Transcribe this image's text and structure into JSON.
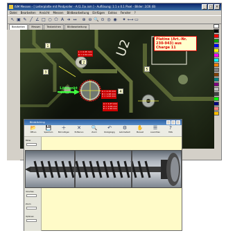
{
  "main_window": {
    "title": "ISM Messen - [ Leiterplatte mit Pindproller - A:\\1.1\\x.ism ] - Auflösung: 1:1 x 0.1 Pixel - Bilder: 2/26 (B)",
    "menu": [
      "Datei",
      "Bearbeiten",
      "Ansicht",
      "Messen",
      "Bildbearbeitung",
      "Einfügen",
      "Extras",
      "Fenster",
      "?"
    ],
    "tabs": [
      {
        "label": "Bearbeiten",
        "active": true
      },
      {
        "label": "Messen",
        "active": false
      },
      {
        "label": "Textzeichen",
        "active": false
      },
      {
        "label": "Bildbearbeitung",
        "active": false
      }
    ],
    "palette_colors": [
      "#ffffff",
      "#000000",
      "#ff0000",
      "#00a000",
      "#0000ff",
      "#ffff00",
      "#ff00ff",
      "#00ffff",
      "#ff8000",
      "#808080",
      "#804000",
      "#008080",
      "#800080",
      "#c0c0c0",
      "#404040",
      "#00ff00",
      "#000080",
      "#ff8080",
      "#ffc000"
    ]
  },
  "pcb": {
    "callout": "Platine (Art.-Nr. 230-943) aus Charge 11",
    "numbers": [
      "1",
      "2",
      "3",
      "4",
      "5"
    ],
    "green_label": "Lötpunkt ansehen",
    "measurements": [
      [
        "A = 2.15 mm",
        "B = 1.98 mm",
        "C = 1.02 mm"
      ],
      [
        "L = 0.35 mm",
        "R = 0.54 mm"
      ],
      [
        "A = 1.27 mm",
        "D = 0.55 mm",
        "E = 2.44 mm"
      ]
    ],
    "silkscreen": "U2"
  },
  "sub_window": {
    "title": "Bildstitching",
    "toolbar": [
      {
        "icon": "open-icon",
        "label": "Öffnen"
      },
      {
        "icon": "save-icon",
        "label": "Speichern"
      },
      {
        "icon": "add-icon",
        "label": "Bild zufügen"
      },
      {
        "icon": "delete-icon",
        "label": "Entfernen"
      },
      {
        "icon": "zoom-icon",
        "label": "Zoom"
      },
      {
        "icon": "undo-icon",
        "label": "Rückgängig"
      },
      {
        "icon": "auto-icon",
        "label": "Automatisch"
      },
      {
        "icon": "manual-icon",
        "label": "Manuell"
      },
      {
        "icon": "align-icon",
        "label": "Ausrichten"
      },
      {
        "icon": "help-icon",
        "label": "Hilfe"
      }
    ],
    "left": {
      "labels": [
        "Bilder",
        "Überlappung",
        "Modus",
        "Ausrichten",
        "Vorschau",
        "Zoom",
        "Optionen"
      ]
    }
  }
}
